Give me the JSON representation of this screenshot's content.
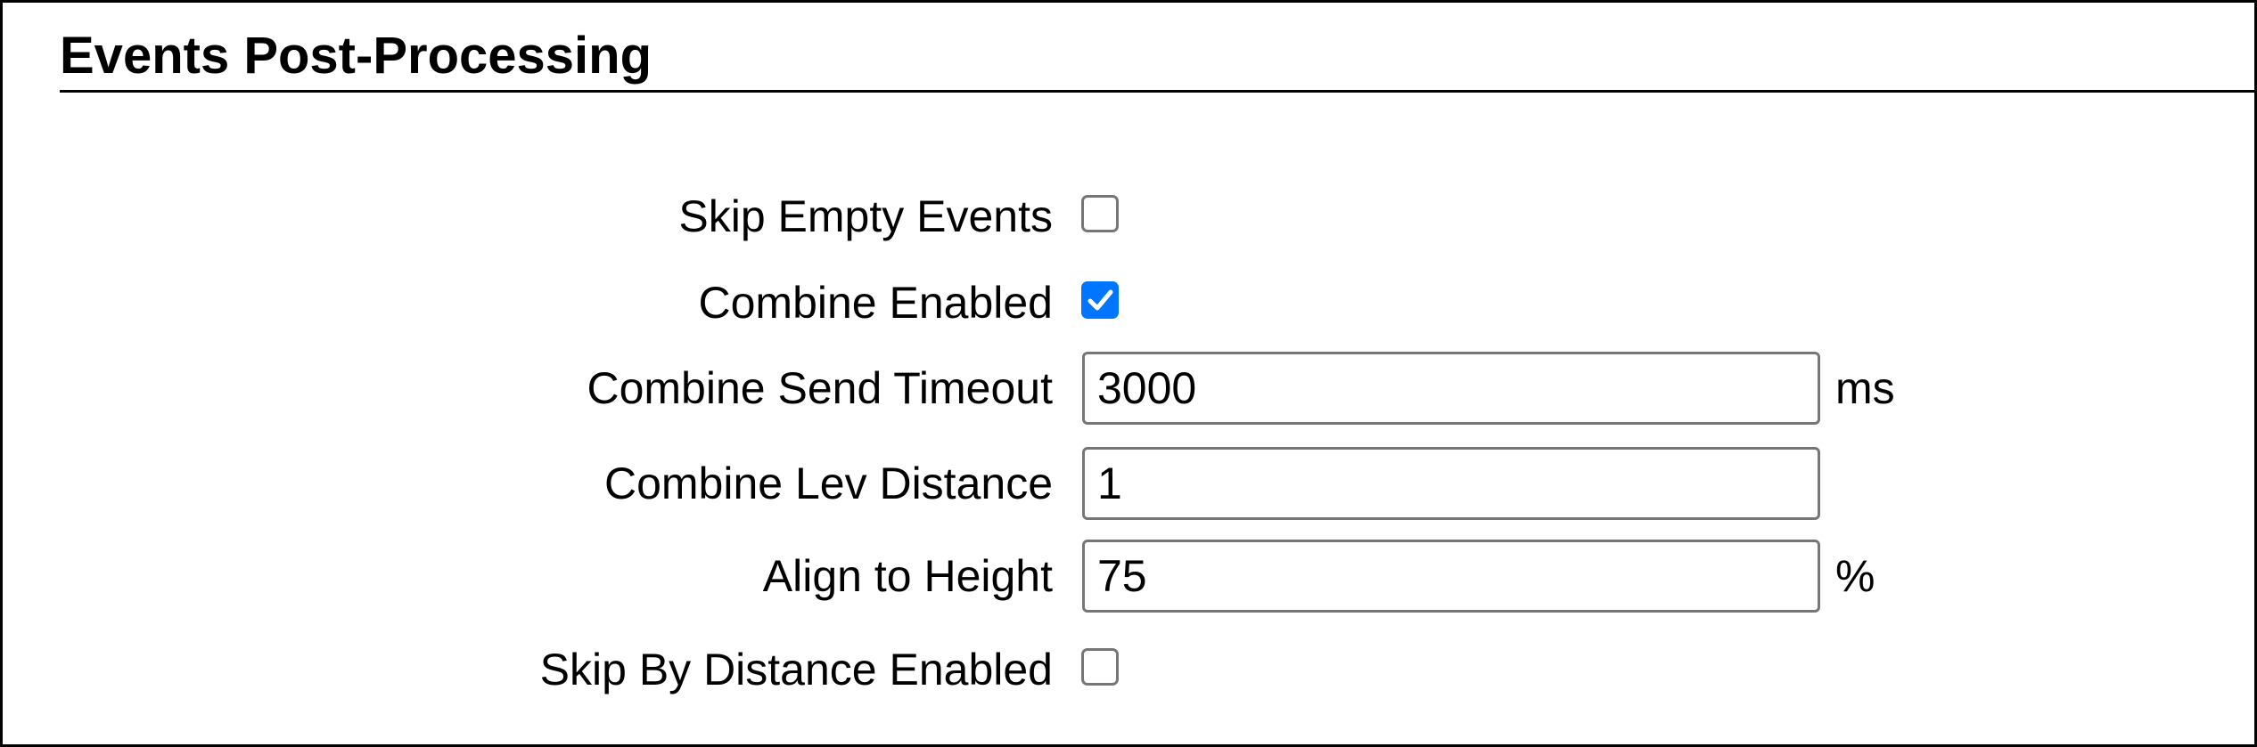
{
  "section": {
    "title": "Events Post-Processing"
  },
  "fields": {
    "skip_empty_events": {
      "label": "Skip Empty Events",
      "checked": false
    },
    "combine_enabled": {
      "label": "Combine Enabled",
      "checked": true
    },
    "combine_send_timeout": {
      "label": "Combine Send Timeout",
      "value": "3000",
      "unit": "ms"
    },
    "combine_lev_distance": {
      "label": "Combine Lev Distance",
      "value": "1"
    },
    "align_to_height": {
      "label": "Align to Height",
      "value": "75",
      "unit": "%"
    },
    "skip_by_distance_enabled": {
      "label": "Skip By Distance Enabled",
      "checked": false
    }
  },
  "colors": {
    "checkbox_checked": "#0075ff",
    "control_border": "#767676"
  }
}
